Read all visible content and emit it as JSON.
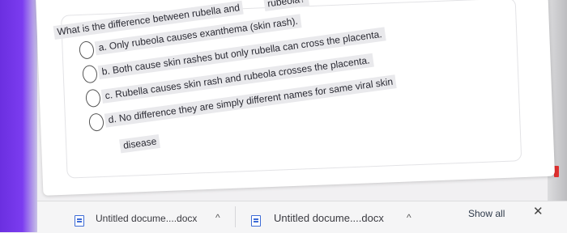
{
  "question": {
    "text_line1": "What is the difference between rubella and",
    "text_line1_end": "rubeola?",
    "options": [
      {
        "label": "a. Only rubeola causes exanthema (skin rash)."
      },
      {
        "label": "b. Both cause skin rashes but only rubella can cross the placenta."
      },
      {
        "label": "c. Rubella causes skin rash and rubeola crosses the placenta."
      },
      {
        "label": "d. No difference they are simply different names for same viral skin"
      }
    ],
    "option_d_continuation": "disease"
  },
  "downloads": {
    "items": [
      {
        "name": "Untitled docume....docx",
        "icon": "docx-file-icon"
      },
      {
        "name": "Untitled docume....docx",
        "icon": "docx-file-icon"
      }
    ],
    "show_all_label": "Show all",
    "close_glyph": "✕",
    "chevron_glyph": "^"
  },
  "colors": {
    "accent_left": "#7b3cf0",
    "text_highlight": "#e9e9ec",
    "side_marker": "#e0302f"
  }
}
